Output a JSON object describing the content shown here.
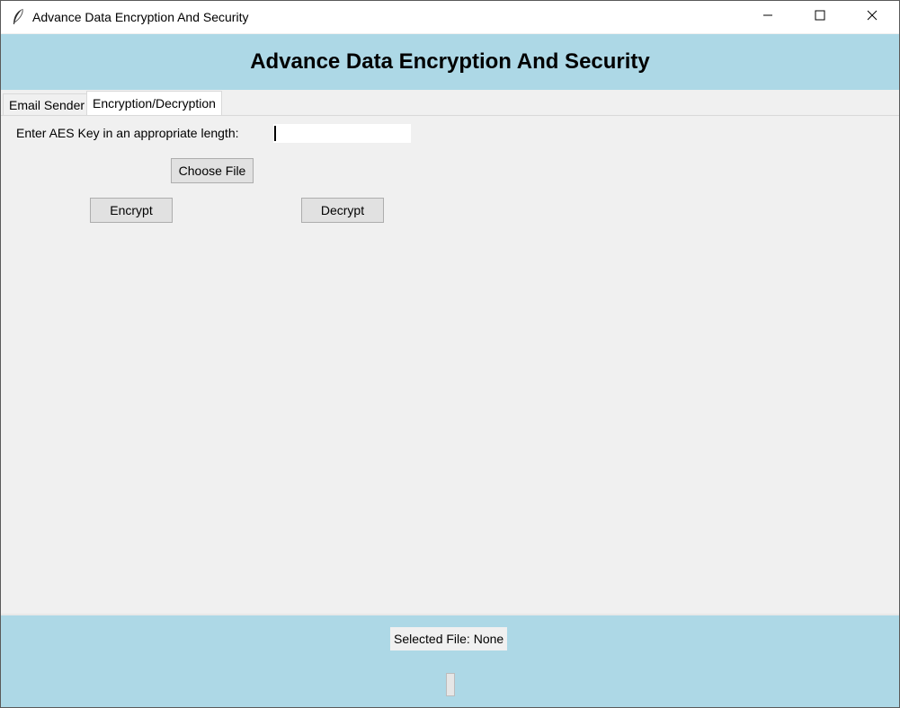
{
  "window": {
    "title": "Advance Data Encryption And Security",
    "icon": "feather-icon",
    "controls": [
      "minimize-icon",
      "maximize-icon",
      "close-icon"
    ]
  },
  "header": {
    "title": "Advance Data Encryption And Security",
    "background": "#add8e6"
  },
  "tabs": [
    {
      "label": "Email Sender",
      "selected": false
    },
    {
      "label": "Encryption/Decryption",
      "selected": true
    }
  ],
  "encryption_tab": {
    "key_label": "Enter AES Key in an appropriate length:",
    "key_value": "",
    "choose_file_label": "Choose File",
    "encrypt_label": "Encrypt",
    "decrypt_label": "Decrypt"
  },
  "footer": {
    "selected_file": "Selected File: None",
    "progress_percent": 0,
    "background": "#add8e6"
  }
}
